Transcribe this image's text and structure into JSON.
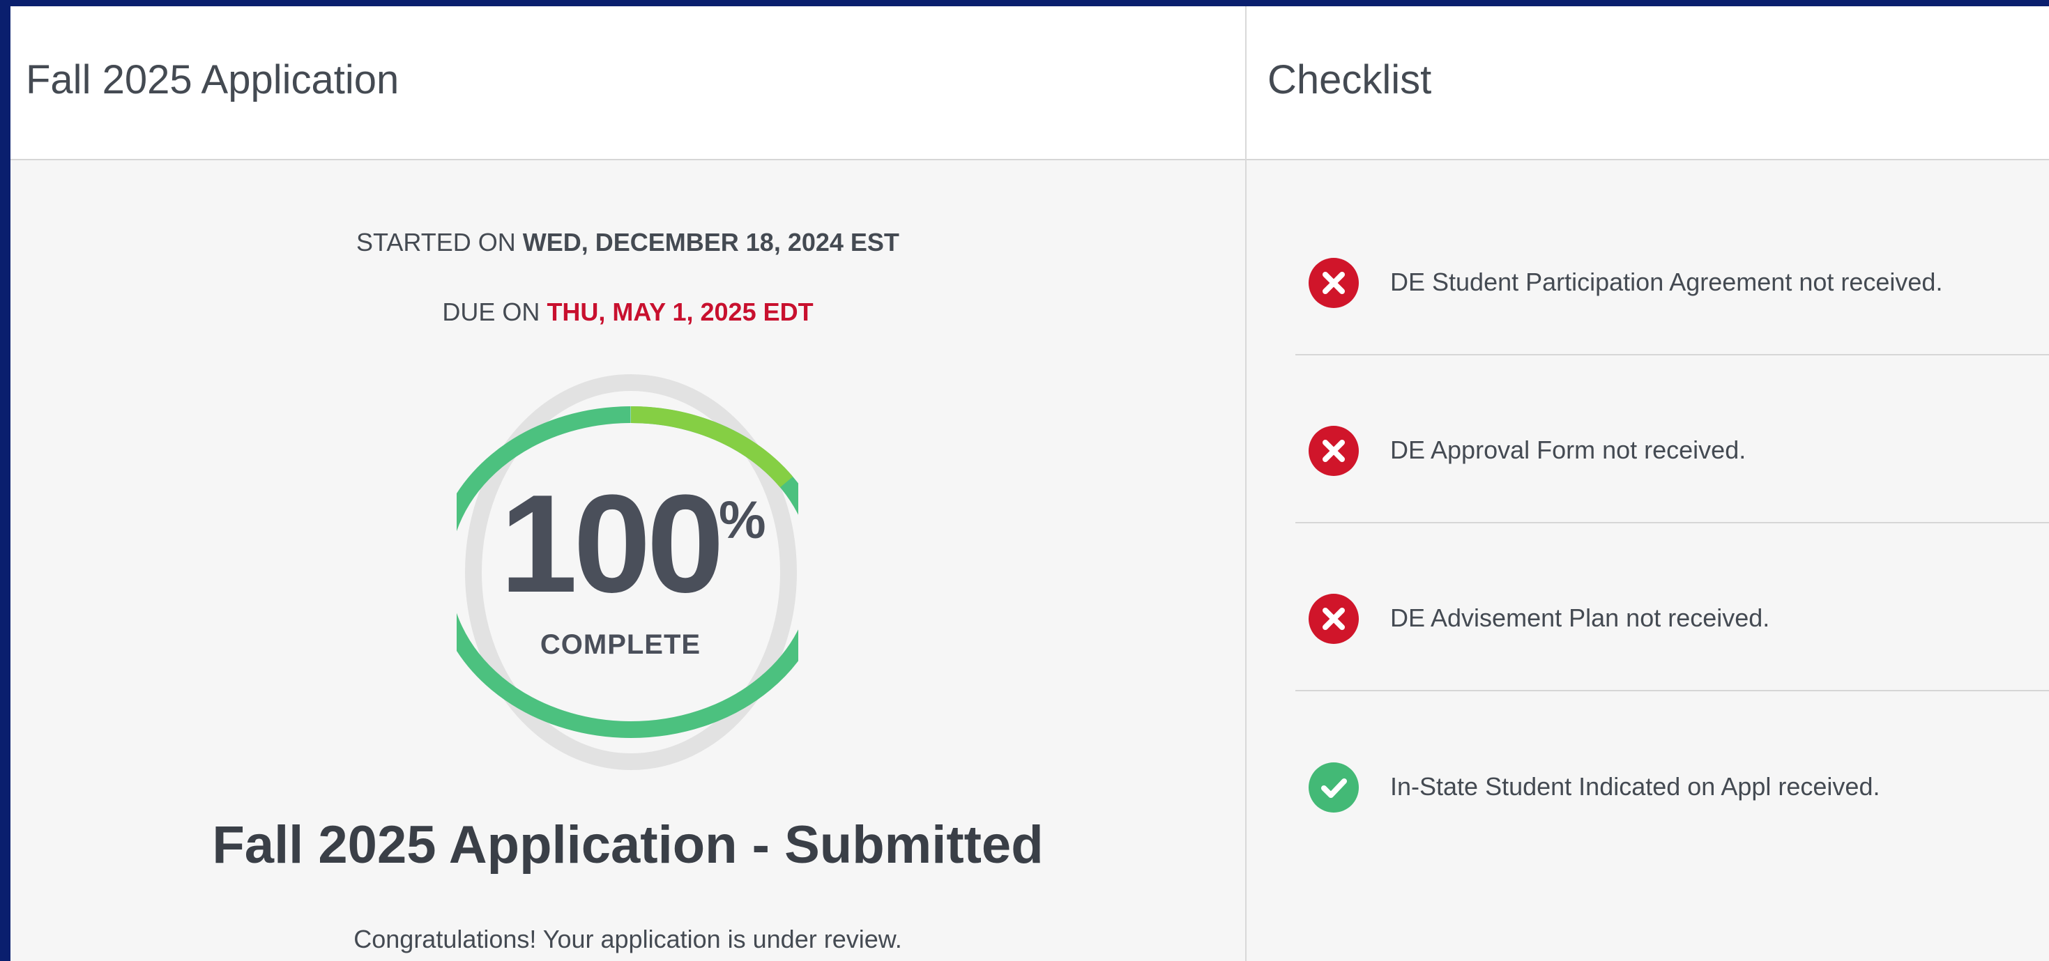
{
  "application": {
    "title": "Fall 2025 Application",
    "started_prefix": "STARTED ON",
    "started_date": "WED, DECEMBER 18, 2024 EST",
    "due_prefix": "DUE ON",
    "due_date": "THU, MAY 1, 2025 EDT",
    "progress": {
      "percent": 100,
      "percent_text": "100",
      "percent_sign": "%",
      "label": "COMPLETE"
    },
    "status_heading": "Fall 2025 Application - Submitted",
    "status_message": "Congratulations! Your application is under review."
  },
  "checklist": {
    "title": "Checklist",
    "items": [
      {
        "text": "DE Student Participation Agreement not received.",
        "status": "missing",
        "icon": "x-circle-icon"
      },
      {
        "text": "DE Approval Form not received.",
        "status": "missing",
        "icon": "x-circle-icon"
      },
      {
        "text": "DE Advisement Plan not received.",
        "status": "missing",
        "icon": "x-circle-icon"
      },
      {
        "text": "In-State Student Indicated on Appl received.",
        "status": "received",
        "icon": "check-circle-icon"
      }
    ]
  },
  "colors": {
    "page_background": "#0a1f6e",
    "due_date": "#c8102e",
    "missing": "#d0152a",
    "received": "#43b976",
    "ring_main": "#4cc17f",
    "ring_accent": "#8fd13a"
  }
}
